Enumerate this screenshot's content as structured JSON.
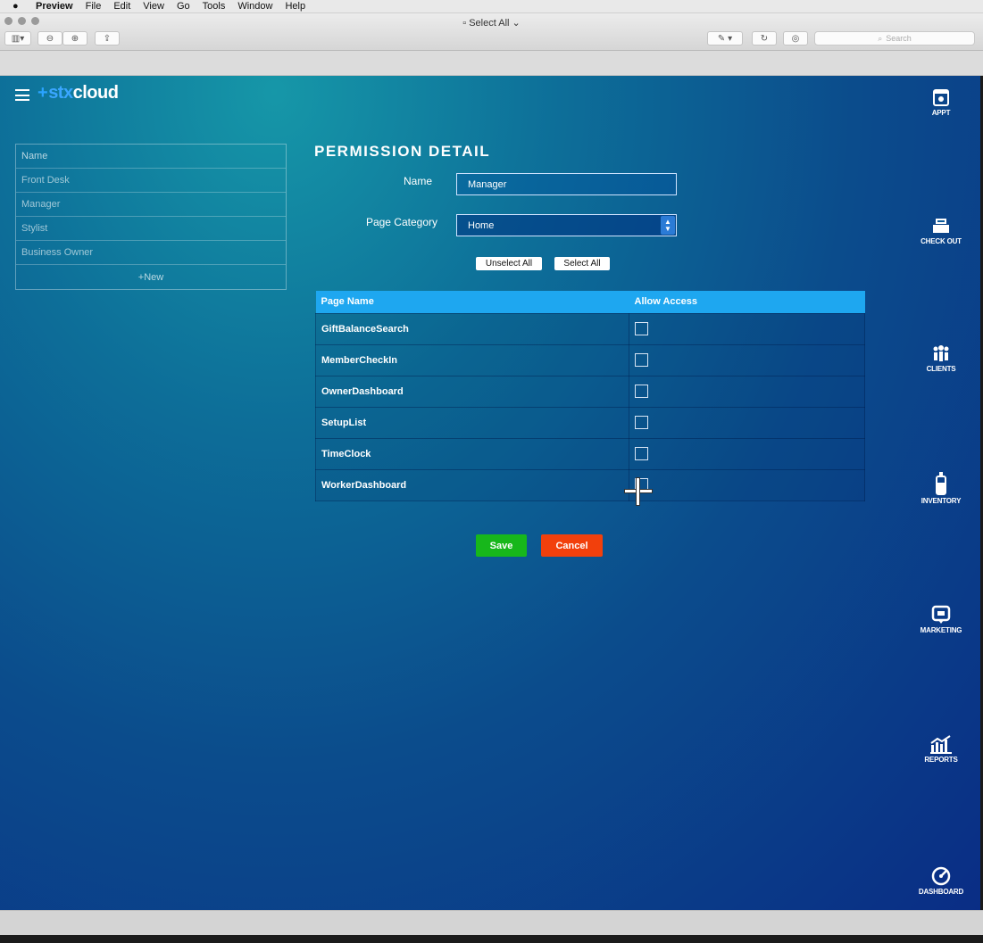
{
  "menubar": {
    "app": "Preview",
    "items": [
      "File",
      "Edit",
      "View",
      "Go",
      "Tools",
      "Window",
      "Help"
    ]
  },
  "window": {
    "title": "Select All",
    "search_placeholder": "Search"
  },
  "app": {
    "logo_prefix": "stx",
    "logo_suffix": "cloud",
    "name_list": {
      "header": "Name",
      "items": [
        "Front Desk",
        "Manager",
        "Stylist",
        "Business Owner"
      ],
      "new_label": "+New"
    },
    "page_title": "PERMISSION DETAIL",
    "form": {
      "name_label": "Name",
      "name_value": "Manager",
      "category_label": "Page Category",
      "category_value": "Home"
    },
    "buttons": {
      "unselect_all": "Unselect All",
      "select_all": "Select All",
      "save": "Save",
      "cancel": "Cancel"
    },
    "table": {
      "headers": [
        "Page Name",
        "Allow Access"
      ],
      "rows": [
        {
          "page": "GiftBalanceSearch",
          "allow": false
        },
        {
          "page": "MemberCheckIn",
          "allow": false
        },
        {
          "page": "OwnerDashboard",
          "allow": false
        },
        {
          "page": "SetupList",
          "allow": false
        },
        {
          "page": "TimeClock",
          "allow": false
        },
        {
          "page": "WorkerDashboard",
          "allow": false
        }
      ]
    },
    "right_nav": [
      {
        "label": "APPT",
        "icon": "calendar-icon"
      },
      {
        "label": "CHECK OUT",
        "icon": "register-icon"
      },
      {
        "label": "CLIENTS",
        "icon": "people-icon"
      },
      {
        "label": "INVENTORY",
        "icon": "bottle-icon"
      },
      {
        "label": "MARKETING",
        "icon": "message-icon"
      },
      {
        "label": "REPORTS",
        "icon": "chart-icon"
      },
      {
        "label": "DASHBOARD",
        "icon": "gauge-icon"
      }
    ]
  }
}
